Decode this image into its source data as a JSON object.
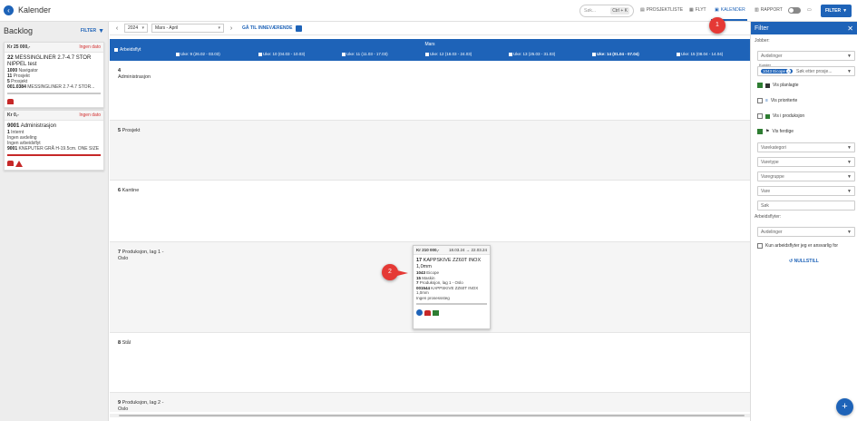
{
  "app": {
    "title": "Kalender"
  },
  "topbar": {
    "search_placeholder": "Søk...",
    "search_shortcut": "Ctrl + K",
    "nav": [
      {
        "label": "PROSJEKTLISTE",
        "icon": "list-icon"
      },
      {
        "label": "FLYT",
        "icon": "flow-icon"
      },
      {
        "label": "KALENDER",
        "icon": "calendar-icon",
        "active": true
      },
      {
        "label": "RAPPORT",
        "icon": "report-icon"
      }
    ],
    "filter_label": "FILTER"
  },
  "backlog": {
    "title": "Backlog",
    "filter_label": "FILTER",
    "cards": [
      {
        "price": "Kr 25 000,-",
        "status": "Ingen dato",
        "title_num": "22",
        "title": "MESSINGLINER 2.7-4.7 STOR NIPPEL test",
        "lines": [
          {
            "num": "1000",
            "text": "Navigator"
          },
          {
            "num": "11",
            "text": "Prosjekt"
          },
          {
            "num": "5",
            "text": "Prosjekt"
          },
          {
            "num": "001.0384",
            "text": "MESSINGLINER 2.7-4.7 STOR..."
          }
        ]
      },
      {
        "price": "Kr 0,-",
        "status": "Ingen dato",
        "title_num": "9001",
        "title": "Administrasjon",
        "lines": [
          {
            "num": "1",
            "text": "Internt"
          },
          {
            "num": "",
            "text": "Ingen avdeling"
          },
          {
            "num": "",
            "text": "Ingen arbeidsflyt"
          },
          {
            "num": "9001",
            "text": "KNEPUTER GRÅ H-19.5cm. ONE SIZE"
          }
        ]
      }
    ]
  },
  "calendar": {
    "year": "2024",
    "range": "Mars - April",
    "today_label": "GÅ TIL INNEVÆRENDE",
    "month_label": "Mars",
    "workflow_label": "Arbeidsflyt",
    "weeks": [
      {
        "label": "Uke: 9 (26.02 - 03.03)"
      },
      {
        "label": "Uke: 10 (04.03 - 10.03)"
      },
      {
        "label": "Uke: 11 (11.03 - 17.03)"
      },
      {
        "label": "Uke: 12 (18.03 - 24.03)"
      },
      {
        "label": "Uke: 13 (25.03 - 31.03)"
      },
      {
        "label": "Uke: 14 (01.04 - 07.04)",
        "current": true
      },
      {
        "label": "Uke: 15 (08.04 - 14.04)"
      }
    ],
    "rows": [
      {
        "num": "4",
        "name": "Administrasjon"
      },
      {
        "num": "5",
        "name": "Prosjekt"
      },
      {
        "num": "6",
        "name": "Kantine"
      },
      {
        "num": "7",
        "name": "Produksjon, lag 1 - Oslo"
      },
      {
        "num": "8",
        "name": "Stål"
      },
      {
        "num": "9",
        "name": "Produksjon, lag 2 - Oslo"
      }
    ],
    "card": {
      "price": "Kr 210 000,-",
      "dates": "18.03.24 → 22.03.24",
      "title_num": "17",
      "title": "KAPPSKIVE ZZ60T INOX 1,0mm",
      "lines": [
        {
          "num": "1043",
          "text": "Eicope"
        },
        {
          "num": "15",
          "text": "Maskin"
        },
        {
          "num": "7",
          "text": "Produksjon, lag 1 - Oslo"
        },
        {
          "num": "001544",
          "text": "KAPPSKIVE ZZ60T INOX 1,0mm"
        },
        {
          "num": "",
          "text": "Ingen prosesssteg"
        }
      ]
    }
  },
  "markers": [
    "1",
    "2"
  ],
  "filter_panel": {
    "title": "Filter",
    "jobber_label": "Jobber:",
    "avdelinger_placeholder": "Avdelinger",
    "kunder_label": "Kunder",
    "chip": "1043 Eicope",
    "kunder_placeholder": "Søk etter prosje...",
    "checks": [
      {
        "label": "Vis planlagte",
        "checked": true
      },
      {
        "label": "Vis prioriterte",
        "checked": false
      },
      {
        "label": "Vis i produksjon",
        "checked": false
      },
      {
        "label": "Vis ferdige",
        "checked": true
      }
    ],
    "selects": [
      "Varekategori",
      "Varetype",
      "Varegruppe",
      "Vare",
      "Søk"
    ],
    "arbeidsflyter_label": "Arbeidsflyter:",
    "arbeidsflyter_placeholder": "Avdelinger",
    "responsible_label": "Kun arbeidsflyter jeg er ansvarlig for",
    "reset_label": "NULLSTILL"
  },
  "colors": {
    "primary": "#1e63b8",
    "danger": "#c62828",
    "success": "#2e7d32"
  }
}
